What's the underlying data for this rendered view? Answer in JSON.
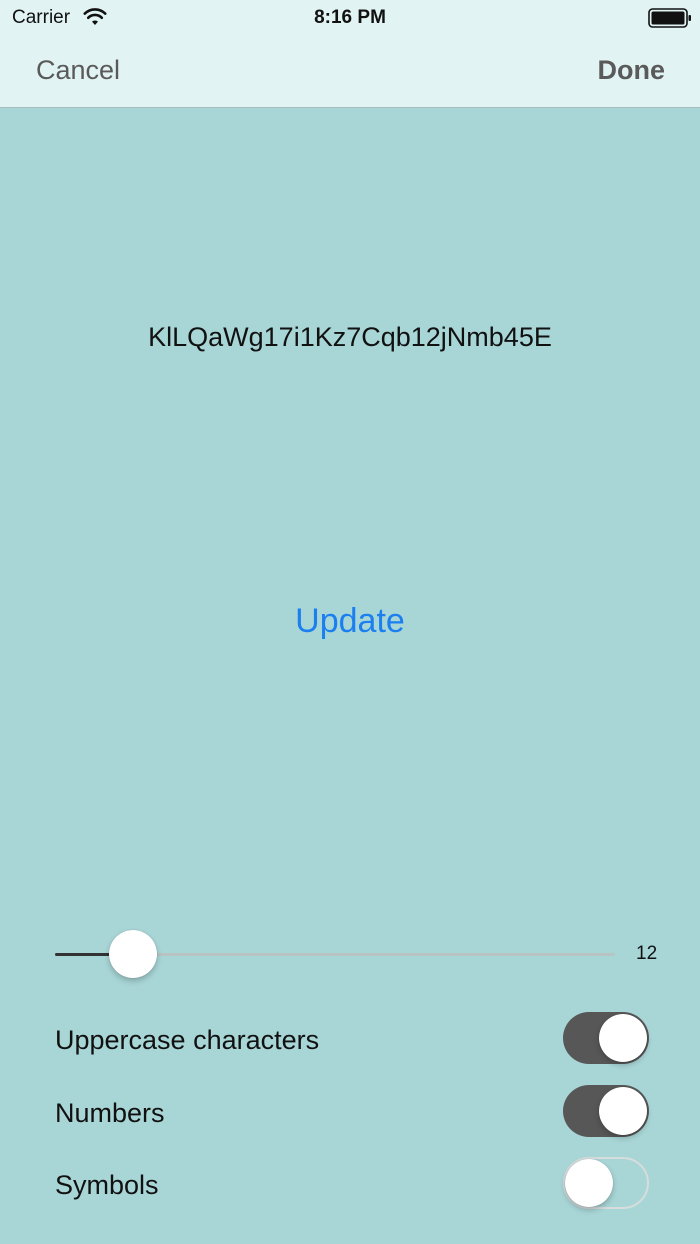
{
  "status_bar": {
    "carrier": "Carrier",
    "time": "8:16 PM",
    "wifi_icon": "wifi-icon",
    "battery_icon": "battery-icon"
  },
  "nav": {
    "cancel_label": "Cancel",
    "done_label": "Done"
  },
  "password": {
    "value": "KlLQaWg17i1Kz7Cqb12jNmb45E"
  },
  "update_label": "Update",
  "length_slider": {
    "min": 0,
    "max": 100,
    "fraction": 0.14,
    "value_label": "12"
  },
  "options": [
    {
      "label": "Uppercase characters",
      "on": true
    },
    {
      "label": "Numbers",
      "on": true
    },
    {
      "label": "Symbols",
      "on": false
    }
  ],
  "colors": {
    "background": "#a8d5d6",
    "nav_background": "#e1f3f2",
    "accent": "#1c7ff0",
    "toggle_on": "#575757"
  }
}
